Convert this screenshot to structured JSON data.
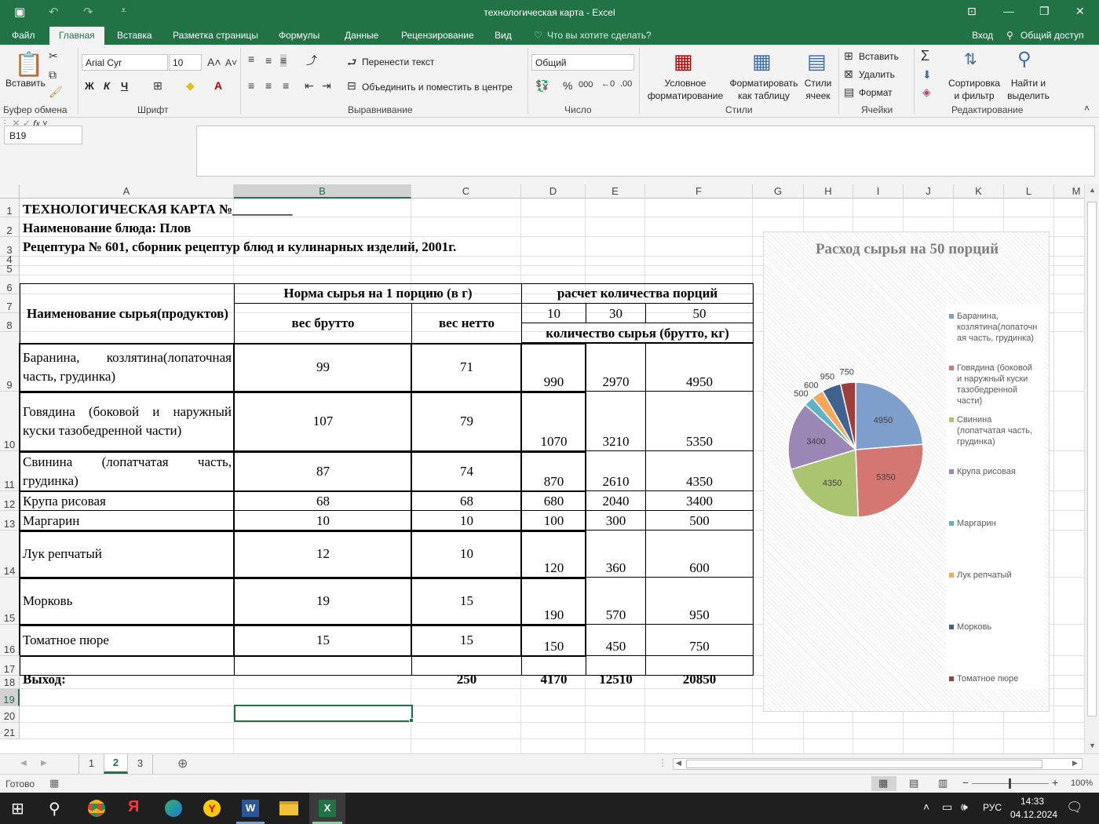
{
  "window": {
    "title": "технологическая карта - Excel",
    "controls": [
      "⊡",
      "—",
      "❐",
      "✕"
    ]
  },
  "ribbon_tabs": [
    "Файл",
    "Главная",
    "Вставка",
    "Разметка страницы",
    "Формулы",
    "Данные",
    "Рецензирование",
    "Вид"
  ],
  "tell_me": "Что вы хотите сделать?",
  "account": {
    "signin": "Вход",
    "share": "Общий доступ"
  },
  "ribbon": {
    "paste": "Вставить",
    "font_name": "Arial Cyr",
    "font_size": "10",
    "bold": "Ж",
    "italic": "К",
    "underline": "Ч",
    "wrap": "Перенести текст",
    "merge": "Объединить и поместить в центре",
    "number_format": "Общий",
    "cond_format": [
      "Условное",
      "форматирование"
    ],
    "as_table": [
      "Форматировать",
      "как таблицу"
    ],
    "cell_styles": [
      "Стили",
      "ячеек"
    ],
    "insert": "Вставить",
    "delete": "Удалить",
    "format": "Формат",
    "sort": [
      "Сортировка",
      "и фильтр"
    ],
    "find": [
      "Найти и",
      "выделить"
    ],
    "groups": {
      "clipboard": "Буфер обмена",
      "font": "Шрифт",
      "alignment": "Выравнивание",
      "number": "Число",
      "styles": "Стили",
      "cells": "Ячейки",
      "editing": "Редактирование"
    }
  },
  "name_box": "B19",
  "fx": "fx",
  "formula": "",
  "columns": [
    "A",
    "B",
    "C",
    "D",
    "E",
    "F",
    "G",
    "H",
    "I",
    "J",
    "K",
    "L",
    "M"
  ],
  "rows": [
    "1",
    "2",
    "3",
    "4",
    "5",
    "6",
    "7",
    "8",
    "9",
    "10",
    "11",
    "12",
    "13",
    "14",
    "15",
    "16",
    "17",
    "18",
    "19",
    "20",
    "21"
  ],
  "sheet": {
    "title1": "ТЕХНОЛОГИЧЕСКАЯ КАРТА №_________",
    "title2": "Наименование блюда: Плов",
    "title3": "Рецептура № 601, сборник рецептур блюд и кулинарных изделий, 2001г.",
    "h_name": "Наименование сырья(продуктов)",
    "h_norm": "Норма сырья на 1 порцию (в г)",
    "h_brutto": "вес брутто",
    "h_netto": "вес нетто",
    "h_calc": "расчет количества порций",
    "h_portions": [
      "10",
      "30",
      "50"
    ],
    "h_qty": "количество сырья (брутто, кг)",
    "items": [
      {
        "name": "Баранина, козлятина(лопаточная часть, грудинка)",
        "brutto": "99",
        "netto": "71",
        "d": "990",
        "e": "2970",
        "f": "4950"
      },
      {
        "name": "Говядина (боковой и наружный куски тазобедренной части)",
        "brutto": "107",
        "netto": "79",
        "d": "1070",
        "e": "3210",
        "f": "5350"
      },
      {
        "name": "Свинина (лопатчатая часть, грудинка)",
        "brutto": "87",
        "netto": "74",
        "d": "870",
        "e": "2610",
        "f": "4350"
      },
      {
        "name": "Крупа рисовая",
        "brutto": "68",
        "netto": "68",
        "d": "680",
        "e": "2040",
        "f": "3400"
      },
      {
        "name": "Маргарин",
        "brutto": "10",
        "netto": "10",
        "d": "100",
        "e": "300",
        "f": "500"
      },
      {
        "name": "Лук репчатый",
        "brutto": "12",
        "netto": "10",
        "d": "120",
        "e": "360",
        "f": "600"
      },
      {
        "name": "Морковь",
        "brutto": "19",
        "netto": "15",
        "d": "190",
        "e": "570",
        "f": "950"
      },
      {
        "name": "Томатное пюре",
        "brutto": "15",
        "netto": "15",
        "d": "150",
        "e": "450",
        "f": "750"
      }
    ],
    "total": {
      "label": "Выход:",
      "netto": "250",
      "d": "4170",
      "e": "12510",
      "f": "20850"
    }
  },
  "chart_data": {
    "type": "pie",
    "title": "Расход сырья на  50 порций",
    "categories": [
      "Баранина, козлятина(лопаточная часть, грудинка)",
      "Говядина (боковой и наружный куски тазобедренной части)",
      "Свинина (лопатчатая часть, грудинка)",
      "Крупа рисовая",
      "Маргарин",
      "Лук репчатый",
      "Морковь",
      "Томатное пюре"
    ],
    "values": [
      4950,
      5350,
      4350,
      3400,
      500,
      600,
      950,
      750
    ],
    "data_labels": [
      "4950",
      "5350",
      "4350",
      "3400",
      "500",
      "600",
      "950",
      "750"
    ],
    "legend_lines": [
      [
        "Баранина,",
        "козлятина(лопаточн",
        "ая часть, грудинка)"
      ],
      [
        "Говядина (боковой",
        "и наружный куски",
        "тазобедренной",
        "части)"
      ],
      [
        "Свинина",
        "(лопатчатая часть,",
        "грудинка)"
      ],
      [
        "Крупа рисовая"
      ],
      [
        "Маргарин"
      ],
      [
        "Лук репчатый"
      ],
      [
        "Морковь"
      ],
      [
        "Томатное пюре"
      ]
    ],
    "colors": [
      "#7e9fcb",
      "#d47773",
      "#abc46f",
      "#9b87b5",
      "#5fb3c9",
      "#f4a95c",
      "#41628e",
      "#9e3f3b"
    ],
    "legend": "right"
  },
  "sheet_tabs": [
    "1",
    "2",
    "3"
  ],
  "active_sheet": "2",
  "status": {
    "ready": "Готово",
    "zoom": "100%"
  },
  "taskbar": {
    "lang": "РУС",
    "time": "14:33",
    "date": "04.12.2024"
  }
}
